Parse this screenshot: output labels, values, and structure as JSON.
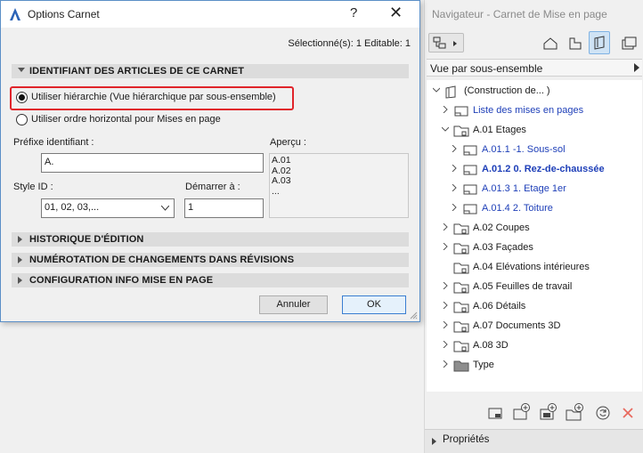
{
  "dialog": {
    "title": "Options Carnet",
    "help_label": "?",
    "close_label": "✕",
    "selection_info": "Sélectionné(s): 1 Editable: 1",
    "section_ids": "IDENTIFIANT DES ARTICLES DE CE CARNET",
    "radio_hierarchy": "Utiliser hiérarchie (Vue hiérarchique par sous-ensemble)",
    "radio_horizontal": "Utiliser ordre horizontal pour Mises en page",
    "prefix_label": "Préfixe identifiant :",
    "prefix_value": "A.",
    "preview_label": "Aperçu :",
    "preview_lines": [
      "A.01",
      "A.02",
      "A.03",
      "..."
    ],
    "style_label": "Style ID :",
    "style_value": "01, 02, 03,...",
    "start_label": "Démarrer à :",
    "start_value": "1",
    "section_history": "HISTORIQUE D'ÉDITION",
    "section_numbering": "NUMÉROTATION DE CHANGEMENTS DANS RÉVISIONS",
    "section_config": "CONFIGURATION INFO MISE EN PAGE",
    "cancel_label": "Annuler",
    "ok_label": "OK",
    "highlight_color": "#e0242b"
  },
  "navigator": {
    "title": "Navigateur - Carnet de Mise en page",
    "view_selector": "Vue par sous-ensemble",
    "tree": [
      {
        "label": "(Construction de... )"
      },
      {
        "label": "Liste des mises en pages"
      },
      {
        "label": "A.01 Etages"
      },
      {
        "label": "A.01.1 -1. Sous-sol"
      },
      {
        "label": "A.01.2 0. Rez-de-chaussée"
      },
      {
        "label": "A.01.3 1. Etage 1er"
      },
      {
        "label": "A.01.4 2. Toiture"
      },
      {
        "label": "A.02 Coupes"
      },
      {
        "label": "A.03 Façades"
      },
      {
        "label": "A.04 Elévations intérieures"
      },
      {
        "label": "A.05 Feuilles de travail"
      },
      {
        "label": "A.06 Détails"
      },
      {
        "label": "A.07 Documents 3D"
      },
      {
        "label": "A.08 3D"
      },
      {
        "label": "Type"
      }
    ],
    "properties_label": "Propriétés",
    "link_color": "#1e3fb8"
  }
}
